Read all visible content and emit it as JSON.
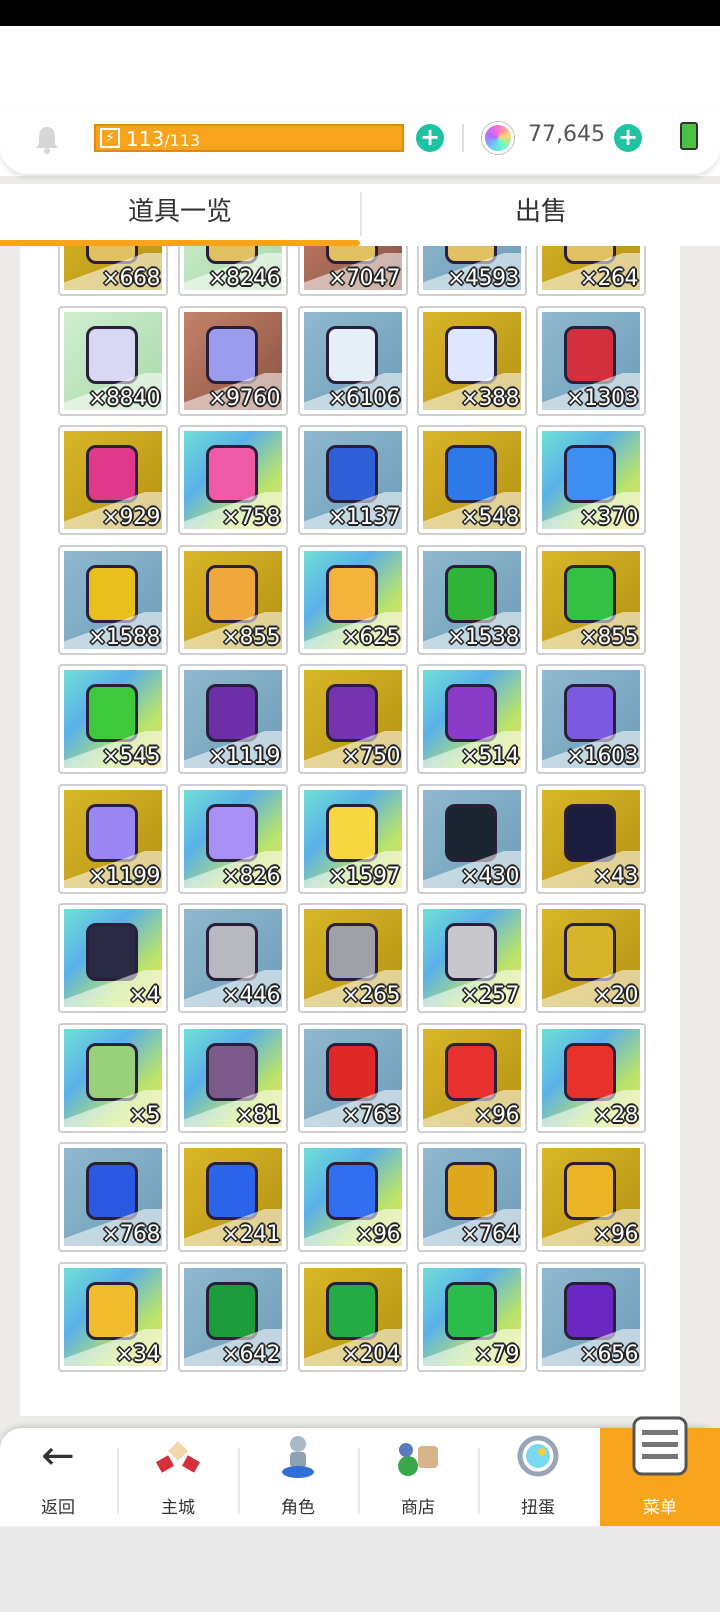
{
  "header": {
    "energy_current": "113",
    "energy_max": "/113",
    "gem_count": "77,645"
  },
  "tabs": {
    "items": "道具一览",
    "sell": "出售"
  },
  "inventory": {
    "partial_top_row": [
      "×668",
      "×8246",
      "×7047",
      "×4593",
      "×264"
    ],
    "items": [
      {
        "qty": "×8840",
        "bg": "green",
        "color": "#d8d8f2"
      },
      {
        "qty": "×9760",
        "bg": "brown",
        "color": "#9c9cee"
      },
      {
        "qty": "×6106",
        "bg": "blue",
        "color": "#e6eef8"
      },
      {
        "qty": "×388",
        "bg": "gold",
        "color": "#dfe6ff"
      },
      {
        "qty": "×1303",
        "bg": "blue",
        "color": "#d2303e"
      },
      {
        "qty": "×929",
        "bg": "gold",
        "color": "#e0388a"
      },
      {
        "qty": "×758",
        "bg": "rainbow",
        "color": "#ee5aa6"
      },
      {
        "qty": "×1137",
        "bg": "blue",
        "color": "#2f5fd8"
      },
      {
        "qty": "×548",
        "bg": "gold",
        "color": "#2f78e8"
      },
      {
        "qty": "×370",
        "bg": "rainbow",
        "color": "#3c8ef0"
      },
      {
        "qty": "×1588",
        "bg": "blue",
        "color": "#e8c01c"
      },
      {
        "qty": "×855",
        "bg": "gold",
        "color": "#f0a83a"
      },
      {
        "qty": "×625",
        "bg": "rainbow",
        "color": "#f4b43c"
      },
      {
        "qty": "×1538",
        "bg": "blue",
        "color": "#2fb43a"
      },
      {
        "qty": "×855",
        "bg": "gold",
        "color": "#34c043"
      },
      {
        "qty": "×545",
        "bg": "rainbow",
        "color": "#3ec83c"
      },
      {
        "qty": "×1119",
        "bg": "blue",
        "color": "#6c2fa8"
      },
      {
        "qty": "×750",
        "bg": "gold",
        "color": "#7434b0"
      },
      {
        "qty": "×514",
        "bg": "rainbow",
        "color": "#8a3cc8"
      },
      {
        "qty": "×1603",
        "bg": "blue",
        "color": "#7a58e0"
      },
      {
        "qty": "×1199",
        "bg": "gold",
        "color": "#9a86f0"
      },
      {
        "qty": "×826",
        "bg": "rainbow",
        "color": "#a890f4"
      },
      {
        "qty": "×1597",
        "bg": "rainbow",
        "color": "#f8d640"
      },
      {
        "qty": "×430",
        "bg": "blue",
        "color": "#1c2630"
      },
      {
        "qty": "×43",
        "bg": "gold",
        "color": "#1c1c3c"
      },
      {
        "qty": "×4",
        "bg": "rainbow",
        "color": "#2a2a44"
      },
      {
        "qty": "×446",
        "bg": "blue",
        "color": "#b8b8c0"
      },
      {
        "qty": "×265",
        "bg": "gold",
        "color": "#a0a0a8"
      },
      {
        "qty": "×257",
        "bg": "rainbow",
        "color": "#c8c8cc"
      },
      {
        "qty": "×20",
        "bg": "gold",
        "color": "#d8b42a"
      },
      {
        "qty": "×5",
        "bg": "rainbow",
        "color": "#9ad07a"
      },
      {
        "qty": "×81",
        "bg": "rainbow",
        "color": "#7c5a8a"
      },
      {
        "qty": "×763",
        "bg": "blue",
        "color": "#e02828"
      },
      {
        "qty": "×96",
        "bg": "gold",
        "color": "#e83030"
      },
      {
        "qty": "×28",
        "bg": "rainbow",
        "color": "#e8302c"
      },
      {
        "qty": "×768",
        "bg": "blue",
        "color": "#2a58e0"
      },
      {
        "qty": "×241",
        "bg": "gold",
        "color": "#2a64e8"
      },
      {
        "qty": "×96",
        "bg": "rainbow",
        "color": "#3070f0"
      },
      {
        "qty": "×764",
        "bg": "blue",
        "color": "#e0a81c"
      },
      {
        "qty": "×96",
        "bg": "gold",
        "color": "#eab424"
      },
      {
        "qty": "×34",
        "bg": "rainbow",
        "color": "#f0bc2c"
      },
      {
        "qty": "×642",
        "bg": "blue",
        "color": "#1c9c3a"
      },
      {
        "qty": "×204",
        "bg": "gold",
        "color": "#24ac44"
      },
      {
        "qty": "×79",
        "bg": "rainbow",
        "color": "#2cbc4c"
      },
      {
        "qty": "×656",
        "bg": "blue",
        "color": "#6a28c0"
      }
    ]
  },
  "bottom_nav": {
    "back": "返回",
    "main_city": "主城",
    "character": "角色",
    "shop": "商店",
    "gacha": "扭蛋",
    "menu": "菜单"
  }
}
